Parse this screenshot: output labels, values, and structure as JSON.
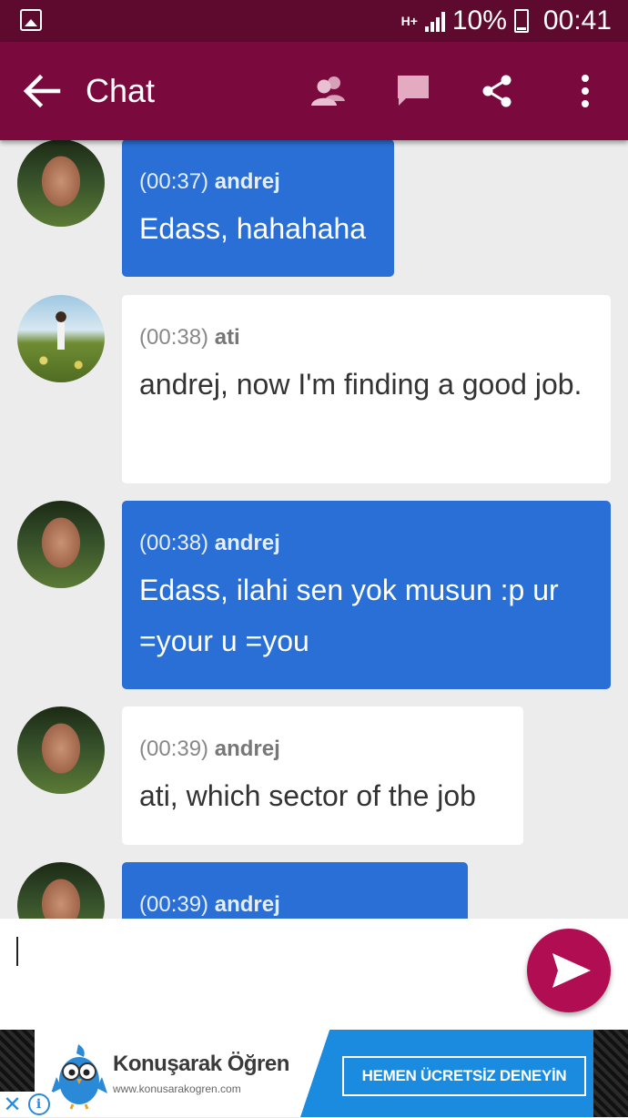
{
  "status_bar": {
    "network": "H+",
    "battery": "10%",
    "time": "00:41"
  },
  "app_bar": {
    "title": "Chat"
  },
  "messages": [
    {
      "time": "(00:37)",
      "author": "andrej",
      "text": "Edass, hahahaha",
      "style": "blue"
    },
    {
      "time": "(00:38)",
      "author": "ati",
      "text": "andrej, now I'm finding a good job.",
      "style": "white"
    },
    {
      "time": "(00:38)",
      "author": "andrej",
      "text": "Edass, ilahi sen yok musun :p ur =your u =you",
      "style": "blue"
    },
    {
      "time": "(00:39)",
      "author": "andrej",
      "text": "ati, which sector of the job",
      "style": "white"
    },
    {
      "time": "(00:39)",
      "author": "andrej",
      "text": "",
      "style": "blue"
    }
  ],
  "composer": {
    "value": ""
  },
  "ad": {
    "brand": "Konuşarak Öğren",
    "url": "www.konusarakogren.com",
    "cta": "HEMEN ÜCRETSİZ DENEYİN"
  },
  "colors": {
    "status_bar": "#5e0a2f",
    "app_bar": "#7a0a3e",
    "bubble_blue": "#2a6fd5",
    "bubble_white": "#ffffff",
    "send_button": "#b00d52",
    "background": "#ececec"
  },
  "icons": {
    "status_left": "gallery-icon",
    "back": "arrow-left-icon",
    "people": "people-icon",
    "chat": "chat-bubble-icon",
    "share": "share-icon",
    "more": "more-vertical-icon",
    "send": "send-icon"
  }
}
